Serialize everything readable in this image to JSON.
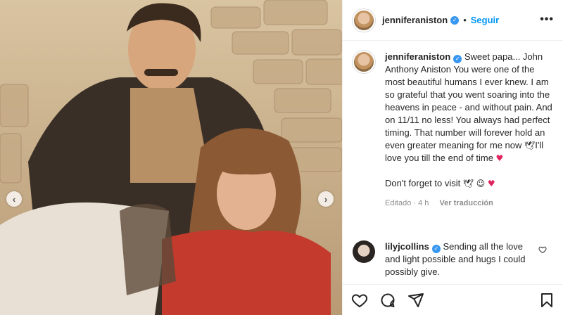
{
  "post": {
    "username": "jenniferaniston",
    "verified_mark": "✓",
    "follow_label": "Seguir",
    "separator": "•",
    "more_label": "•••"
  },
  "caption": {
    "username": "jenniferaniston",
    "text": "Sweet papa... John Anthony Aniston You were one of the most beautiful humans I ever knew. I am so grateful that you went soaring into the heavens in peace - and without pain. And on 11/11 no less! You always had perfect timing. That number will forever hold an even greater meaning for me now",
    "text_tail": "I'll love you till the end of time",
    "visit_text": "Don't forget to visit",
    "emoji_a": "🕊",
    "emoji_heart": "♥",
    "emoji_b": "☺",
    "meta_edited": "Editado · 4 h",
    "meta_translate": "Ver traducción"
  },
  "comment": {
    "username": "lilyjcollins",
    "text": "Sending all the love and light possible and hugs I could possibly give."
  },
  "icons": {
    "like": "heart-icon",
    "comment": "comment-icon",
    "share": "share-icon",
    "save": "bookmark-icon"
  },
  "colors": {
    "accent": "#0095f6",
    "verified": "#3897f0",
    "muted": "#8e8e8e"
  }
}
